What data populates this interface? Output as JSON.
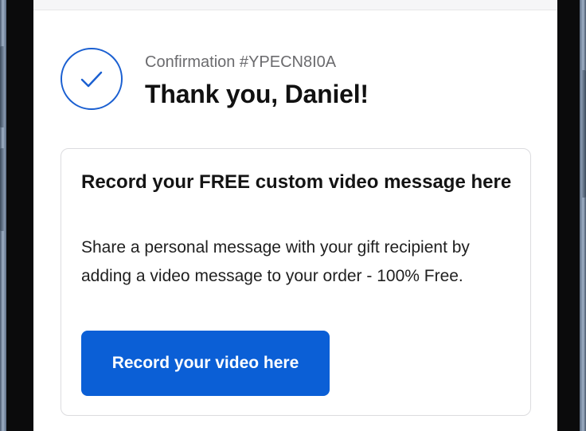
{
  "confirmation": {
    "number_text": "Confirmation #YPECN8I0A",
    "thank_you": "Thank you, Daniel!"
  },
  "video_card": {
    "title": "Record your FREE custom video message here",
    "description": "Share a personal message with your gift recipient by adding a video message to your order - 100% Free.",
    "button_label": "Record your video here"
  },
  "icons": {
    "confirmation": "checkmark-circle-icon"
  },
  "colors": {
    "accent": "#0b5fd6",
    "check_stroke": "#1a5fd1",
    "frame": "#0b0b0c"
  }
}
